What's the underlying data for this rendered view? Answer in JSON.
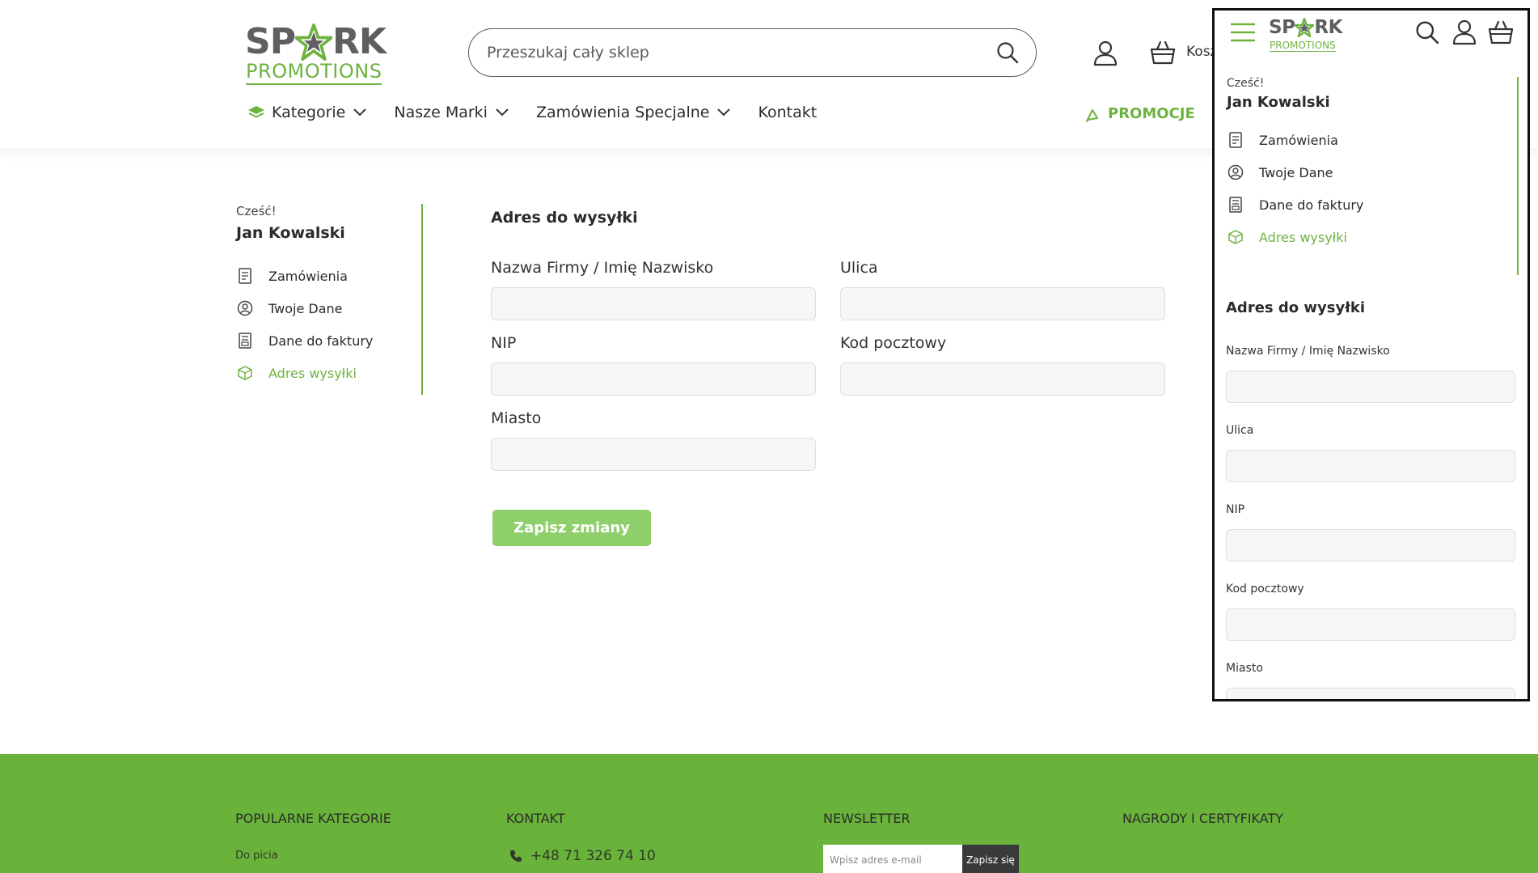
{
  "brand": {
    "logo_top_left": "SP",
    "logo_top_right": "RK",
    "logo_bottom": "PROMOTIONS",
    "accent_color": "#6db33f",
    "icon": "star-icon"
  },
  "header": {
    "search_placeholder": "Przeszukaj cały sklep",
    "cart_label": "Koszyk"
  },
  "nav": {
    "items": [
      {
        "label": "Kategorie",
        "icon": "layers-icon",
        "dropdown": true
      },
      {
        "label": "Nasze Marki",
        "dropdown": true
      },
      {
        "label": "Zamówienia Specjalne",
        "dropdown": true
      },
      {
        "label": "Kontakt",
        "dropdown": false
      }
    ],
    "promo_label": "PROMOCJE"
  },
  "account": {
    "greeting": "Cześć!",
    "user_name": "Jan Kowalski",
    "menu": [
      {
        "label": "Zamówienia",
        "icon": "document-icon"
      },
      {
        "label": "Twoje Dane",
        "icon": "user-circle-icon"
      },
      {
        "label": "Dane do faktury",
        "icon": "invoice-icon"
      },
      {
        "label": "Adres wysyłki",
        "icon": "package-icon",
        "active": true
      }
    ]
  },
  "form": {
    "title": "Adres do wysyłki",
    "fields": {
      "company": {
        "label": "Nazwa Firmy / Imię Nazwisko",
        "value": ""
      },
      "street": {
        "label": "Ulica",
        "value": ""
      },
      "nip": {
        "label": "NIP",
        "value": ""
      },
      "postal": {
        "label": "Kod pocztowy",
        "value": ""
      },
      "city": {
        "label": "Miasto",
        "value": ""
      }
    },
    "save_label": "Zapisz zmiany"
  },
  "footer": {
    "popular_heading": "POPULARNE KATEGORIE",
    "popular_first": "Do picia",
    "contact_heading": "KONTAKT",
    "phone": "+48 71 326 74 10",
    "newsletter_heading": "NEWSLETTER",
    "newsletter_placeholder": "Wpisz adres e-mail",
    "newsletter_button": "Zapisz się",
    "awards_heading": "NAGRODY I CERTYFIKATY"
  }
}
